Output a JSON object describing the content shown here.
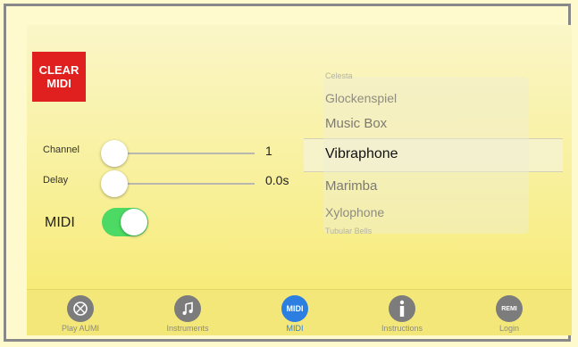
{
  "clear_button": {
    "line1": "CLEAR",
    "line2": "MIDI"
  },
  "controls": {
    "channel": {
      "label": "Channel",
      "value": "1",
      "level": 0
    },
    "delay": {
      "label": "Delay",
      "value": "0.0s",
      "level": 0
    },
    "midi": {
      "label": "MIDI",
      "on": true
    }
  },
  "picker": {
    "items": [
      "Celesta",
      "Glockenspiel",
      "Music Box",
      "Vibraphone",
      "Marimba",
      "Xylophone",
      "Tubular Bells"
    ],
    "selected": "Vibraphone"
  },
  "tabs": [
    {
      "label": "Play AUMI",
      "icon": "aumi-icon",
      "text": ""
    },
    {
      "label": "Instruments",
      "icon": "music-note-icon",
      "text": ""
    },
    {
      "label": "MIDI",
      "icon": "midi-icon",
      "text": "MIDI"
    },
    {
      "label": "Instructions",
      "icon": "info-icon",
      "text": ""
    },
    {
      "label": "Login",
      "icon": "remi-icon",
      "text": "REMI"
    }
  ],
  "active_tab": "MIDI",
  "colors": {
    "clear": "#e0201e",
    "toggle_on": "#4cd964",
    "active_tab": "#2c7ee0"
  }
}
